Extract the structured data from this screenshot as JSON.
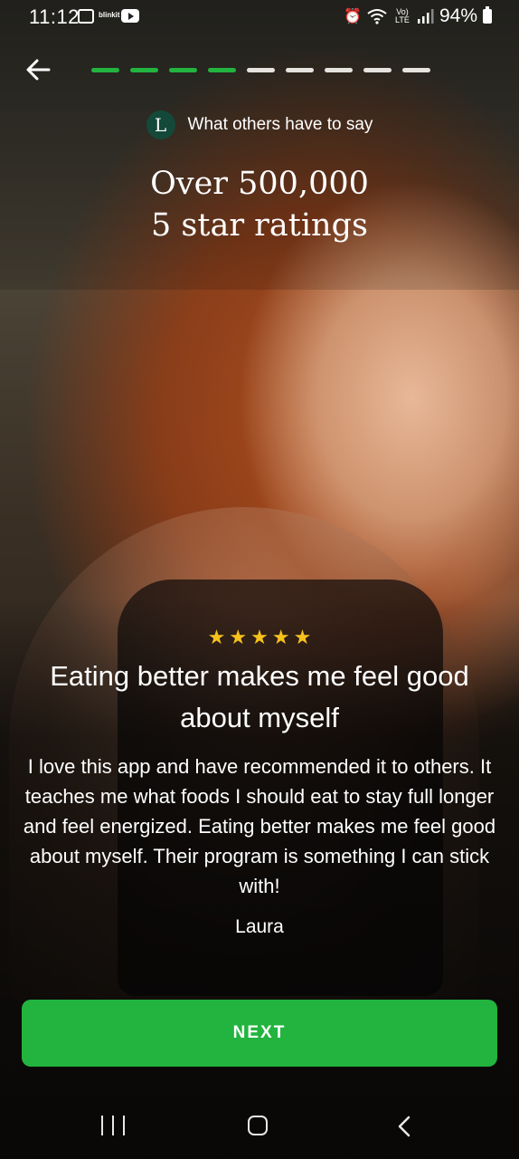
{
  "status_bar": {
    "time": "11:12",
    "notif_text": "blinkit",
    "network": "Vo) LTE",
    "battery": "94%"
  },
  "header": {
    "back_icon": "arrow-left-icon",
    "progress_done": 4,
    "progress_total": 9
  },
  "brand": {
    "logo_letter": "L",
    "subtitle": "What others have to say"
  },
  "headline": {
    "line1": "Over 500,000",
    "line2": "5 star ratings"
  },
  "review": {
    "rating": 5,
    "star_char": "★",
    "title": "Eating better makes me feel good about myself",
    "body": "I love this app and have recommended it to others. It teaches me what foods I should eat to stay full longer and feel energized. Eating better makes me feel good about myself. Their program is something I can stick with!",
    "author": "Laura"
  },
  "cta": {
    "label": "NEXT"
  },
  "colors": {
    "accent": "#22b43f",
    "star": "#f7c21c",
    "logo_bg": "#14493a"
  }
}
